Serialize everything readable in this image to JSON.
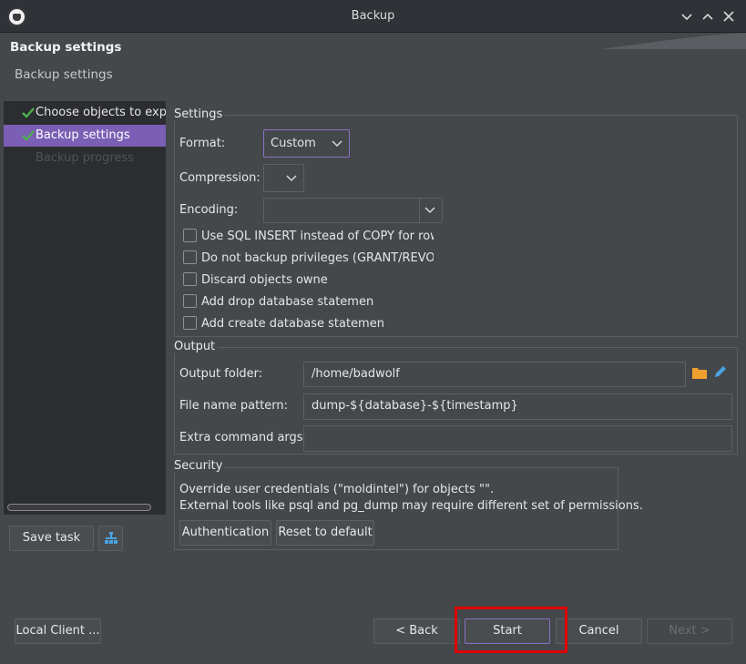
{
  "window": {
    "title": "Backup",
    "controls": [
      "chevron-down-icon",
      "chevron-up-icon",
      "close-icon"
    ]
  },
  "header": {
    "title": "Backup settings",
    "subtitle": "Backup settings"
  },
  "nav": {
    "items": [
      {
        "label": "Choose objects to expo",
        "state": "done"
      },
      {
        "label": "Backup settings",
        "state": "active"
      },
      {
        "label": "Backup progress",
        "state": "disabled"
      }
    ]
  },
  "settings": {
    "title": "Settings",
    "format_label": "Format:",
    "format_value": "Custom",
    "compression_label": "Compression:",
    "compression_value": "",
    "encoding_label": "Encoding:",
    "encoding_value": "",
    "checkboxes": [
      {
        "label": "Use SQL INSERT instead of COPY for row",
        "checked": false
      },
      {
        "label": "Do not backup privileges (GRANT/REVOKE",
        "checked": false
      },
      {
        "label": "Discard objects owne",
        "checked": false
      },
      {
        "label": "Add drop database statemen",
        "checked": false
      },
      {
        "label": "Add create database statemen",
        "checked": false
      }
    ]
  },
  "output": {
    "title": "Output",
    "folder_label": "Output folder:",
    "folder_value": "/home/badwolf",
    "pattern_label": "File name pattern:",
    "pattern_value": "dump-${database}-${timestamp}",
    "args_label": "Extra command args:",
    "args_value": ""
  },
  "security": {
    "title": "Security",
    "line1": "Override user credentials (\"moldintel\") for objects \"\".",
    "line2": "External tools like psql and pg_dump may require different set of permissions.",
    "auth_button": "Authentication",
    "reset_button": "Reset to default"
  },
  "footer": {
    "save_task": "Save task",
    "local_client": "Local Client ...",
    "back": "< Back",
    "start": "Start",
    "cancel": "Cancel",
    "next": "Next >"
  },
  "colors": {
    "accent": "#7a5fb4",
    "check": "#4caf50",
    "folder": "#f0a030",
    "pencil": "#4aa3df",
    "highlight": "#e00000"
  }
}
